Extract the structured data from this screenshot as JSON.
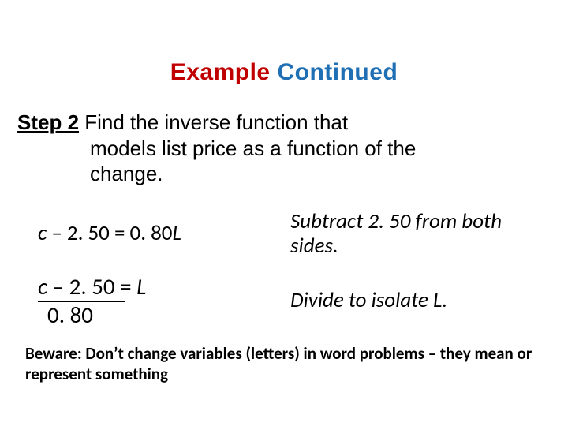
{
  "title": {
    "word1": "Example",
    "word2": "Continued"
  },
  "step": {
    "label": "Step 2",
    "line1": "  Find the inverse function that",
    "line2": "models list price as a function of the",
    "line3": "change."
  },
  "work": {
    "eq1": {
      "c": "c",
      "mid": " – 2. 50 = 0. 80",
      "L": "L"
    },
    "exp1": "Subtract 2. 50 from both sides.",
    "eq2": {
      "num_c": "c",
      "num_rest": " – 2. 50 = ",
      "num_L": "L",
      "denom": "0. 80"
    },
    "exp2": "Divide to isolate L."
  },
  "beware": "Beware:  Don’t change variables (letters) in word problems – they mean or represent something"
}
